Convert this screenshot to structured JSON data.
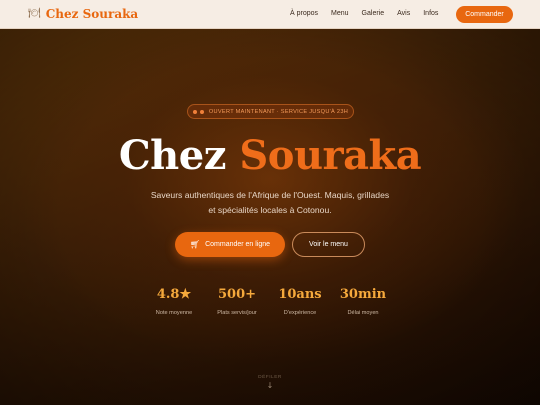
{
  "nav": {
    "brand_icon": "🍽",
    "brand_name": "Chez Souraka",
    "links": [
      "À propos",
      "Menu",
      "Galerie",
      "Avis",
      "Infos"
    ],
    "cta": "Commander"
  },
  "hero": {
    "badge": "OUVERT MAINTENANT · SERVICE JUSQU'À 23H",
    "title_white": "Chez",
    "title_orange": "Souraka",
    "tagline": "Saveurs authentiques de l'Afrique de l'Ouest. Maquis, grillades et spécialités locales à Cotonou.",
    "primary_button": "Commander en ligne",
    "primary_icon": "cart-icon",
    "secondary_button": "Voir le menu"
  },
  "stats": [
    {
      "value": "4.8★",
      "label": "Note moyenne"
    },
    {
      "value": "500+",
      "label": "Plats servis/jour"
    },
    {
      "value": "10ans",
      "label": "D'expérience"
    },
    {
      "value": "30min",
      "label": "Délai moyen"
    }
  ],
  "scroll": {
    "label": "DÉFILER",
    "icon": "arrow-down-icon"
  },
  "colors": {
    "accent": "#e8670f",
    "stat_gold": "#f5a93c",
    "nav_bg": "#f6ede4"
  }
}
